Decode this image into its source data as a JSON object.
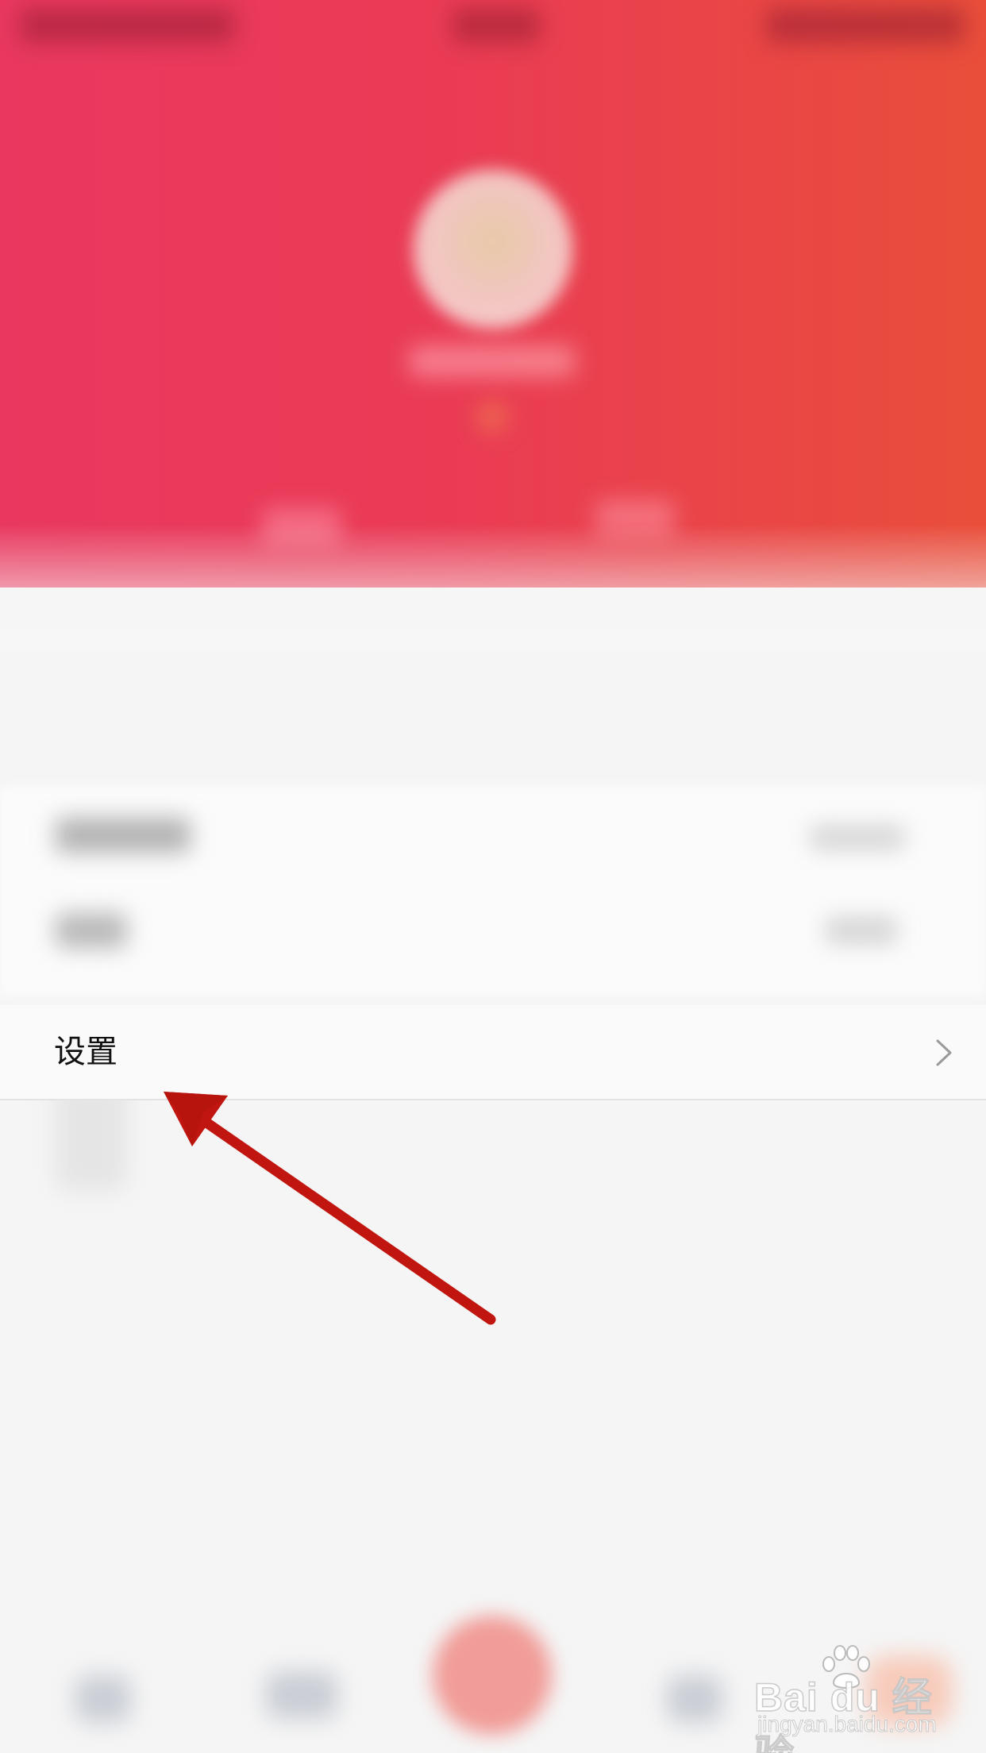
{
  "settings_row": {
    "label": "设置",
    "chevron_icon": "chevron-right-icon"
  },
  "annotation": {
    "arrow_color": "#c0160f",
    "arrow_icon": "red-arrow-annotation"
  },
  "header": {
    "gradient_colors": [
      "#e9385f",
      "#ea3b55",
      "#e94e3a"
    ]
  },
  "watermark": {
    "brand": "Bai du 经验",
    "site": "jingyan.baidu.com"
  }
}
